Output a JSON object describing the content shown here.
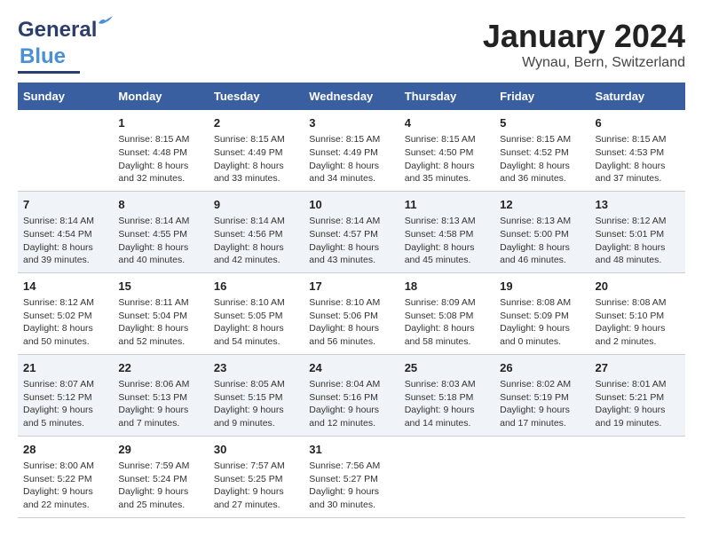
{
  "header": {
    "logo_general": "General",
    "logo_blue": "Blue",
    "title": "January 2024",
    "location": "Wynau, Bern, Switzerland"
  },
  "weekdays": [
    "Sunday",
    "Monday",
    "Tuesday",
    "Wednesday",
    "Thursday",
    "Friday",
    "Saturday"
  ],
  "weeks": [
    [
      {
        "day": "",
        "info": ""
      },
      {
        "day": "1",
        "info": "Sunrise: 8:15 AM\nSunset: 4:48 PM\nDaylight: 8 hours\nand 32 minutes."
      },
      {
        "day": "2",
        "info": "Sunrise: 8:15 AM\nSunset: 4:49 PM\nDaylight: 8 hours\nand 33 minutes."
      },
      {
        "day": "3",
        "info": "Sunrise: 8:15 AM\nSunset: 4:49 PM\nDaylight: 8 hours\nand 34 minutes."
      },
      {
        "day": "4",
        "info": "Sunrise: 8:15 AM\nSunset: 4:50 PM\nDaylight: 8 hours\nand 35 minutes."
      },
      {
        "day": "5",
        "info": "Sunrise: 8:15 AM\nSunset: 4:52 PM\nDaylight: 8 hours\nand 36 minutes."
      },
      {
        "day": "6",
        "info": "Sunrise: 8:15 AM\nSunset: 4:53 PM\nDaylight: 8 hours\nand 37 minutes."
      }
    ],
    [
      {
        "day": "7",
        "info": "Sunrise: 8:14 AM\nSunset: 4:54 PM\nDaylight: 8 hours\nand 39 minutes."
      },
      {
        "day": "8",
        "info": "Sunrise: 8:14 AM\nSunset: 4:55 PM\nDaylight: 8 hours\nand 40 minutes."
      },
      {
        "day": "9",
        "info": "Sunrise: 8:14 AM\nSunset: 4:56 PM\nDaylight: 8 hours\nand 42 minutes."
      },
      {
        "day": "10",
        "info": "Sunrise: 8:14 AM\nSunset: 4:57 PM\nDaylight: 8 hours\nand 43 minutes."
      },
      {
        "day": "11",
        "info": "Sunrise: 8:13 AM\nSunset: 4:58 PM\nDaylight: 8 hours\nand 45 minutes."
      },
      {
        "day": "12",
        "info": "Sunrise: 8:13 AM\nSunset: 5:00 PM\nDaylight: 8 hours\nand 46 minutes."
      },
      {
        "day": "13",
        "info": "Sunrise: 8:12 AM\nSunset: 5:01 PM\nDaylight: 8 hours\nand 48 minutes."
      }
    ],
    [
      {
        "day": "14",
        "info": "Sunrise: 8:12 AM\nSunset: 5:02 PM\nDaylight: 8 hours\nand 50 minutes."
      },
      {
        "day": "15",
        "info": "Sunrise: 8:11 AM\nSunset: 5:04 PM\nDaylight: 8 hours\nand 52 minutes."
      },
      {
        "day": "16",
        "info": "Sunrise: 8:10 AM\nSunset: 5:05 PM\nDaylight: 8 hours\nand 54 minutes."
      },
      {
        "day": "17",
        "info": "Sunrise: 8:10 AM\nSunset: 5:06 PM\nDaylight: 8 hours\nand 56 minutes."
      },
      {
        "day": "18",
        "info": "Sunrise: 8:09 AM\nSunset: 5:08 PM\nDaylight: 8 hours\nand 58 minutes."
      },
      {
        "day": "19",
        "info": "Sunrise: 8:08 AM\nSunset: 5:09 PM\nDaylight: 9 hours\nand 0 minutes."
      },
      {
        "day": "20",
        "info": "Sunrise: 8:08 AM\nSunset: 5:10 PM\nDaylight: 9 hours\nand 2 minutes."
      }
    ],
    [
      {
        "day": "21",
        "info": "Sunrise: 8:07 AM\nSunset: 5:12 PM\nDaylight: 9 hours\nand 5 minutes."
      },
      {
        "day": "22",
        "info": "Sunrise: 8:06 AM\nSunset: 5:13 PM\nDaylight: 9 hours\nand 7 minutes."
      },
      {
        "day": "23",
        "info": "Sunrise: 8:05 AM\nSunset: 5:15 PM\nDaylight: 9 hours\nand 9 minutes."
      },
      {
        "day": "24",
        "info": "Sunrise: 8:04 AM\nSunset: 5:16 PM\nDaylight: 9 hours\nand 12 minutes."
      },
      {
        "day": "25",
        "info": "Sunrise: 8:03 AM\nSunset: 5:18 PM\nDaylight: 9 hours\nand 14 minutes."
      },
      {
        "day": "26",
        "info": "Sunrise: 8:02 AM\nSunset: 5:19 PM\nDaylight: 9 hours\nand 17 minutes."
      },
      {
        "day": "27",
        "info": "Sunrise: 8:01 AM\nSunset: 5:21 PM\nDaylight: 9 hours\nand 19 minutes."
      }
    ],
    [
      {
        "day": "28",
        "info": "Sunrise: 8:00 AM\nSunset: 5:22 PM\nDaylight: 9 hours\nand 22 minutes."
      },
      {
        "day": "29",
        "info": "Sunrise: 7:59 AM\nSunset: 5:24 PM\nDaylight: 9 hours\nand 25 minutes."
      },
      {
        "day": "30",
        "info": "Sunrise: 7:57 AM\nSunset: 5:25 PM\nDaylight: 9 hours\nand 27 minutes."
      },
      {
        "day": "31",
        "info": "Sunrise: 7:56 AM\nSunset: 5:27 PM\nDaylight: 9 hours\nand 30 minutes."
      },
      {
        "day": "",
        "info": ""
      },
      {
        "day": "",
        "info": ""
      },
      {
        "day": "",
        "info": ""
      }
    ]
  ]
}
